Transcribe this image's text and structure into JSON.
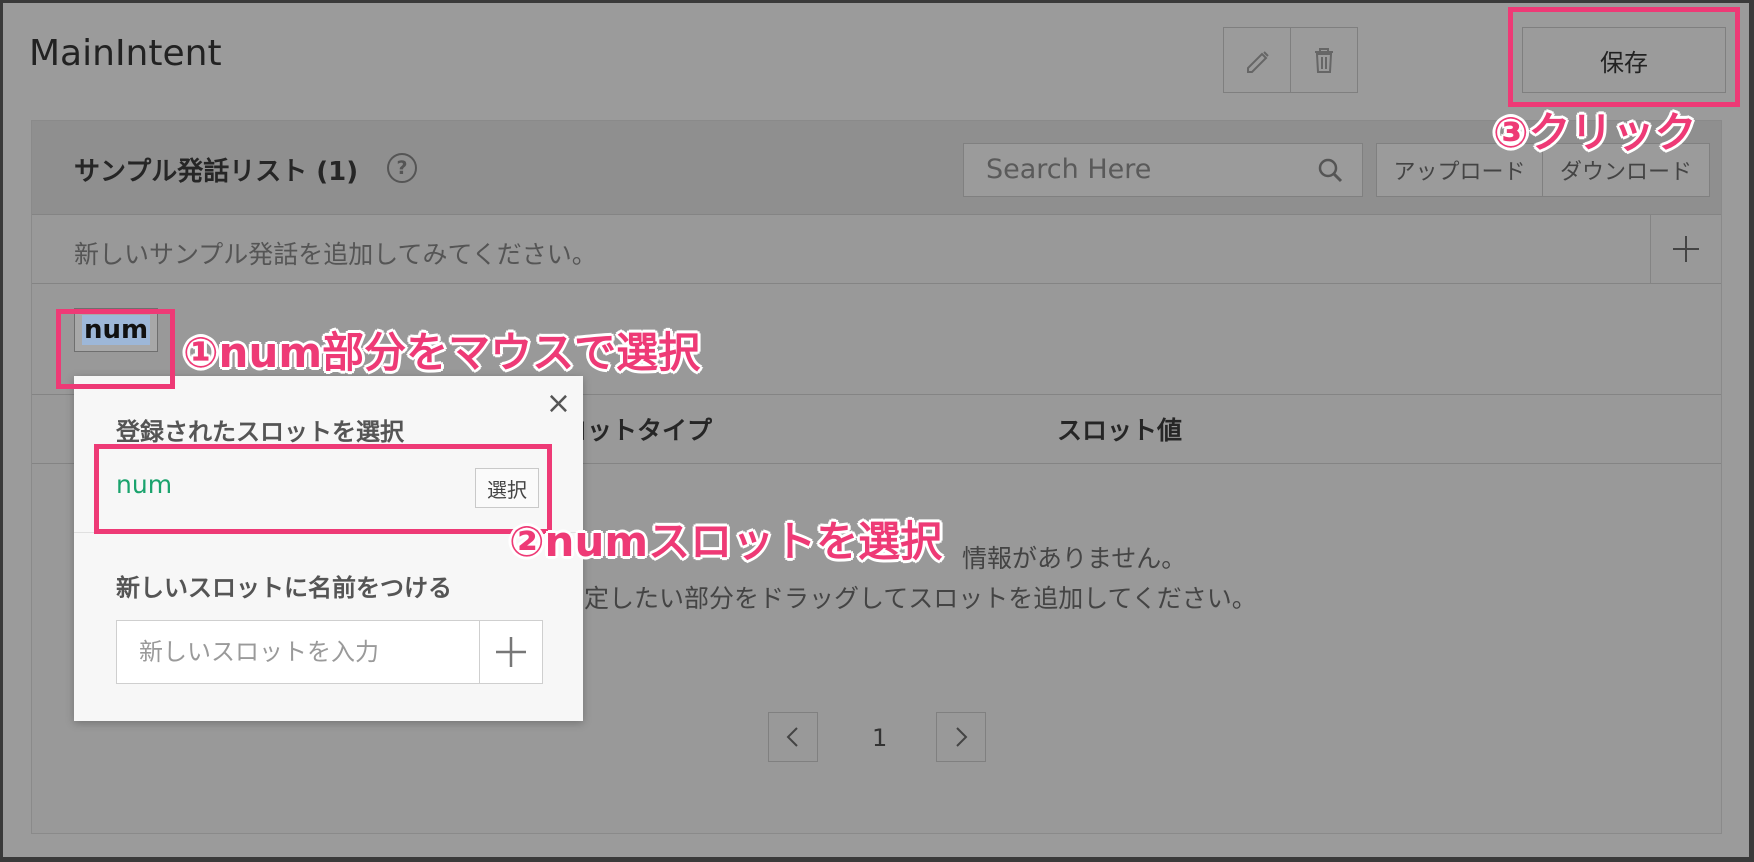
{
  "header": {
    "title": "MainIntent",
    "save_label": "保存"
  },
  "sample_list": {
    "title": "サンプル発話リスト (1)",
    "help": "?",
    "search_placeholder": "Search Here",
    "upload_label": "アップロード",
    "download_label": "ダウンロード",
    "add_placeholder": "新しいサンプル発話を追加してみてください。",
    "utterance_token": "num"
  },
  "slot_table": {
    "columns": [
      "ロットタイプ",
      "スロット値"
    ],
    "empty_line1": "情報がありません。",
    "empty_line2": "定したい部分をドラッグしてスロットを追加してください。"
  },
  "pagination": {
    "prev": "<",
    "page": "1",
    "next": ">"
  },
  "popup": {
    "close": "×",
    "registered_title": "登録されたスロットを選択",
    "slot_name": "num",
    "select_label": "選択",
    "new_title": "新しいスロットに名前をつける",
    "new_placeholder": "新しいスロットを入力"
  },
  "annotations": {
    "step1": "①num部分をマウスで選択",
    "step2": "②numスロットを選択",
    "step3": "③クリック",
    "color": "#ee3a76"
  }
}
